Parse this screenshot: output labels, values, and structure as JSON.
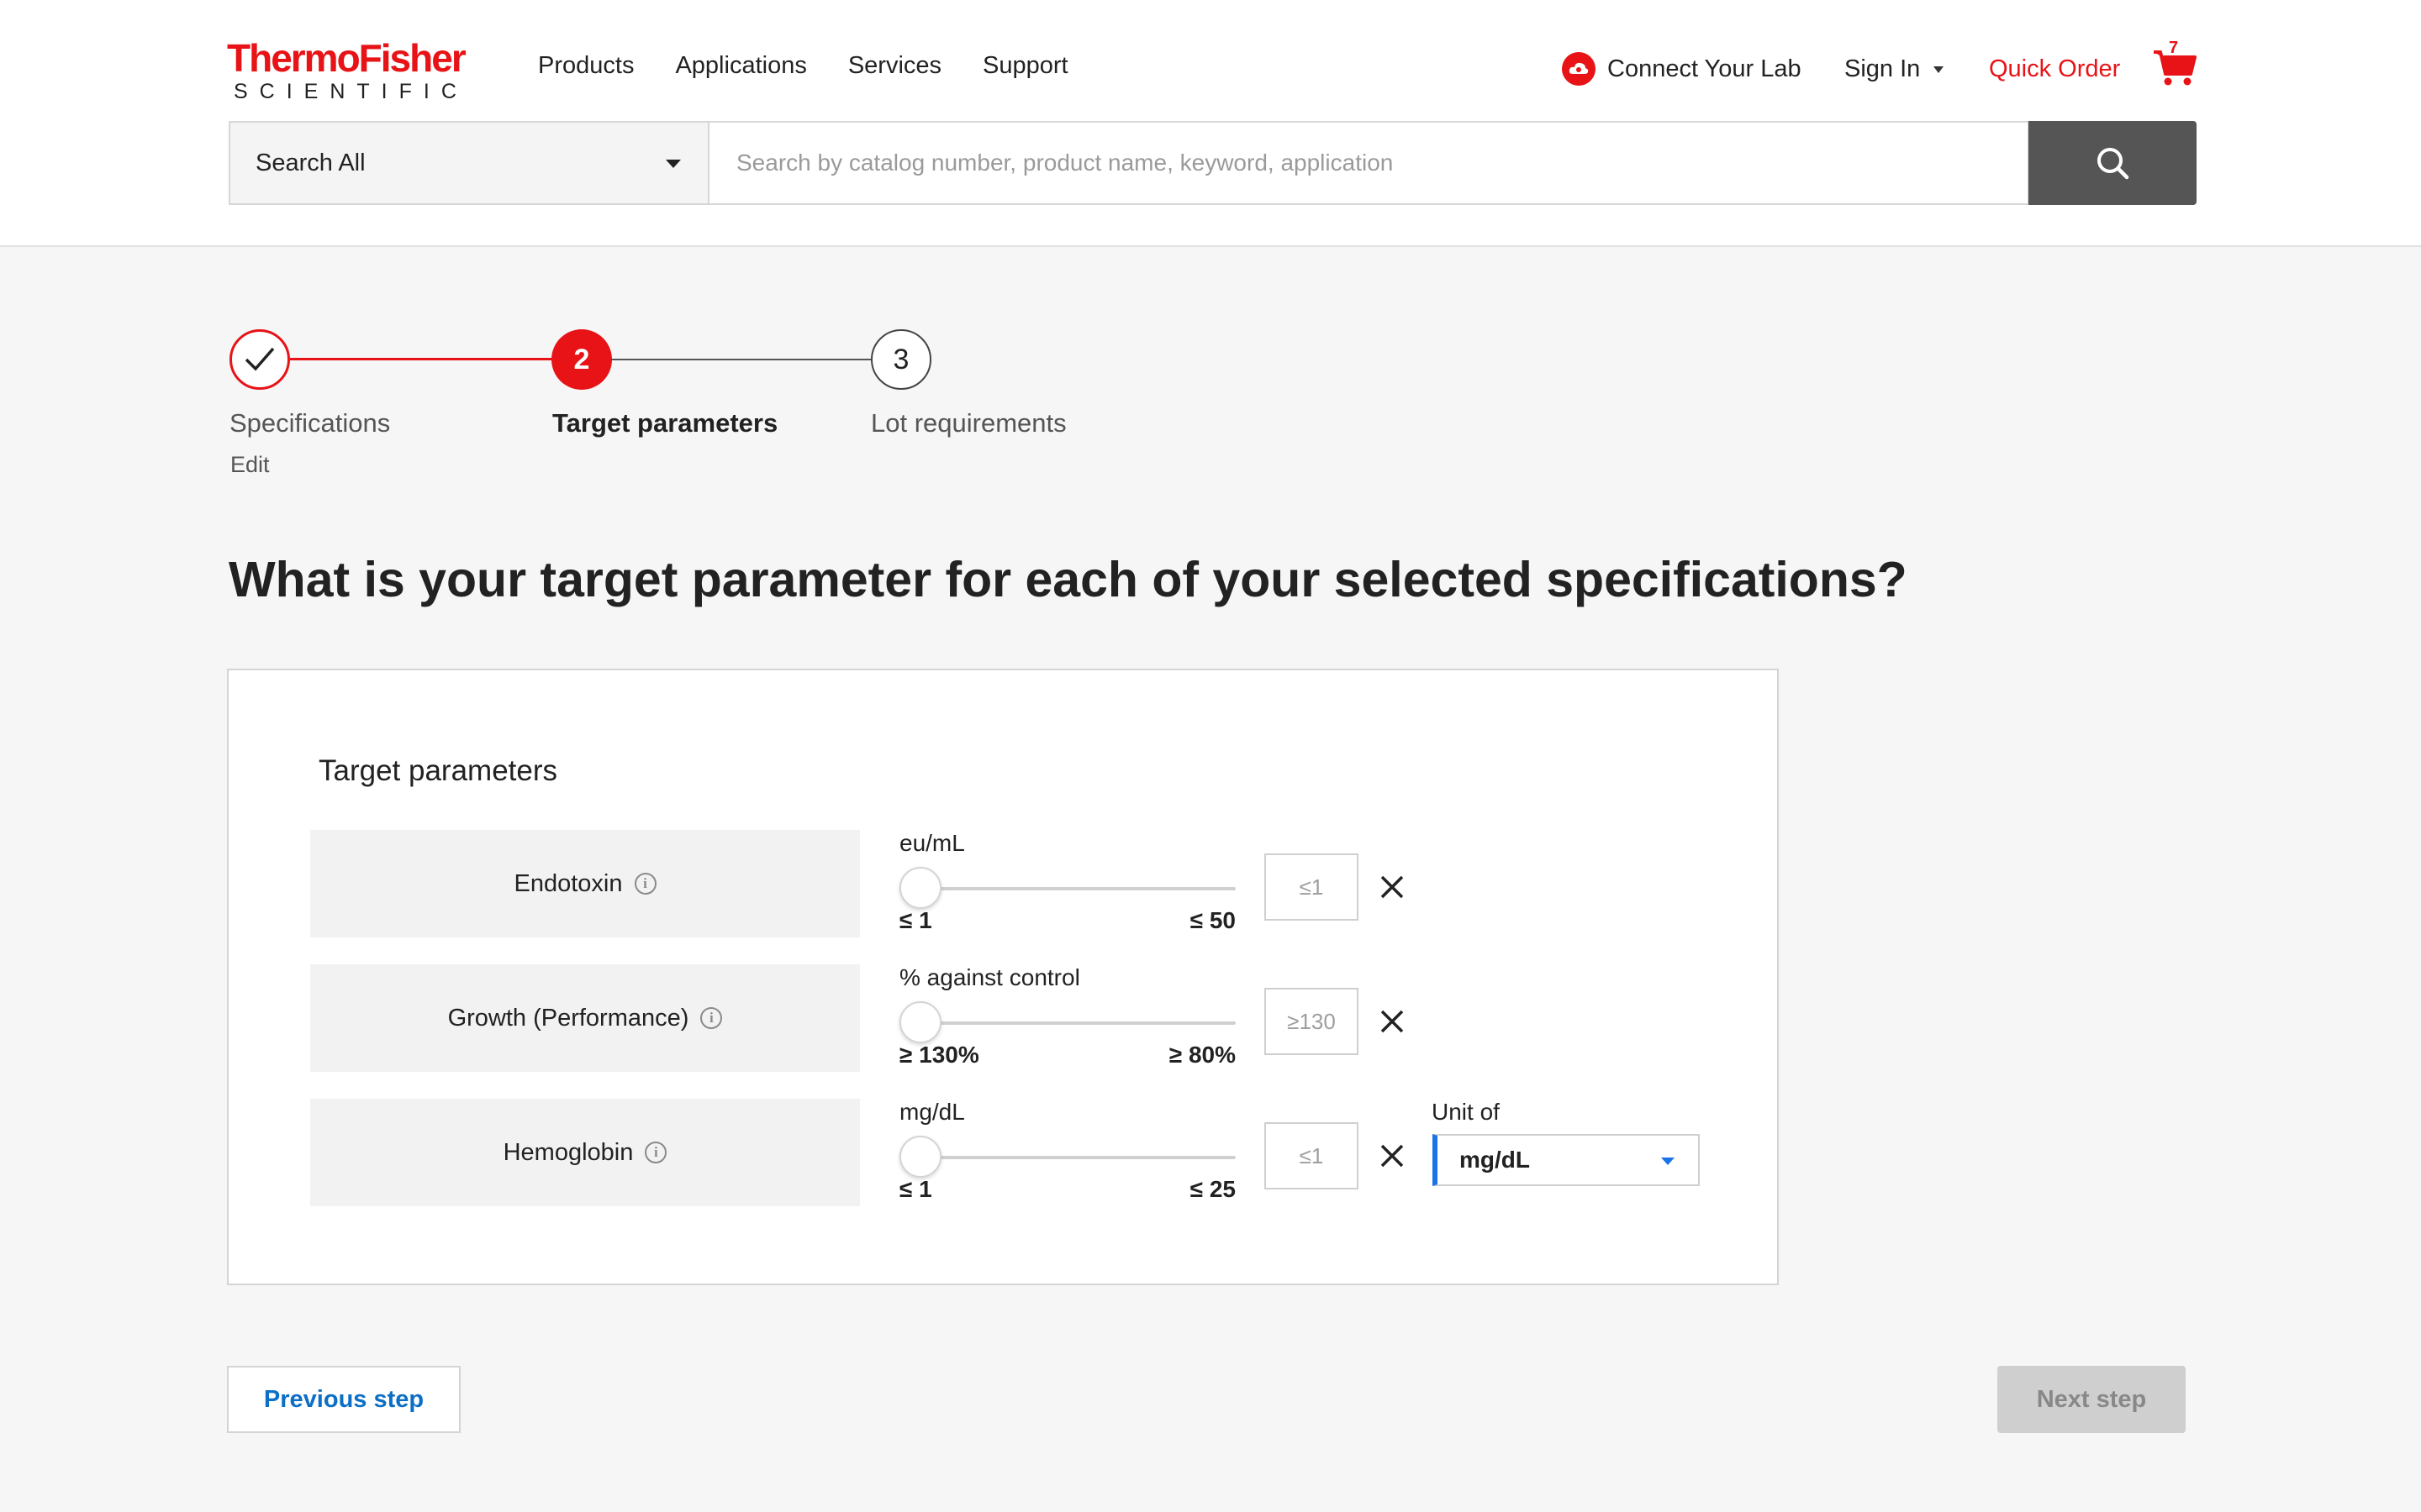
{
  "header": {
    "logo": {
      "line1": "ThermoFisher",
      "line2": "SCIENTIFIC"
    },
    "nav": [
      "Products",
      "Applications",
      "Services",
      "Support"
    ],
    "connect_lab": "Connect Your Lab",
    "sign_in": "Sign In",
    "quick_order": "Quick Order",
    "cart_count": "7",
    "search": {
      "scope": "Search All",
      "placeholder": "Search by catalog number, product name, keyword, application"
    }
  },
  "stepper": {
    "steps": [
      {
        "number": "",
        "label": "Specifications",
        "state": "complete",
        "sub_link": "Edit"
      },
      {
        "number": "2",
        "label": "Target parameters",
        "state": "active"
      },
      {
        "number": "3",
        "label": "Lot requirements",
        "state": "upcoming"
      }
    ]
  },
  "question": "What is your target parameter for each of your selected specifications?",
  "card": {
    "title": "Target parameters",
    "parameters": [
      {
        "name": "Endotoxin",
        "unit_label": "eu/mL",
        "min_label": "≤ 1",
        "max_label": "≤ 50",
        "slider_position": 0,
        "input_placeholder": "≤1"
      },
      {
        "name": "Growth (Performance)",
        "unit_label": "% against control",
        "min_label": "≥ 130%",
        "max_label": "≥ 80%",
        "slider_position": 0,
        "input_placeholder": "≥130"
      },
      {
        "name": "Hemoglobin",
        "unit_label": "mg/dL",
        "min_label": "≤ 1",
        "max_label": "≤ 25",
        "slider_position": 0,
        "input_placeholder": "≤1",
        "unit_of_label": "Unit of",
        "unit_of_value": "mg/dL"
      }
    ]
  },
  "buttons": {
    "previous": "Previous step",
    "next": "Next step"
  },
  "colors": {
    "brand_red": "#e71316",
    "link_blue": "#0b6fc5",
    "select_accent": "#1a73e8",
    "search_button": "#555555",
    "disabled_button": "#cfcfcf"
  }
}
